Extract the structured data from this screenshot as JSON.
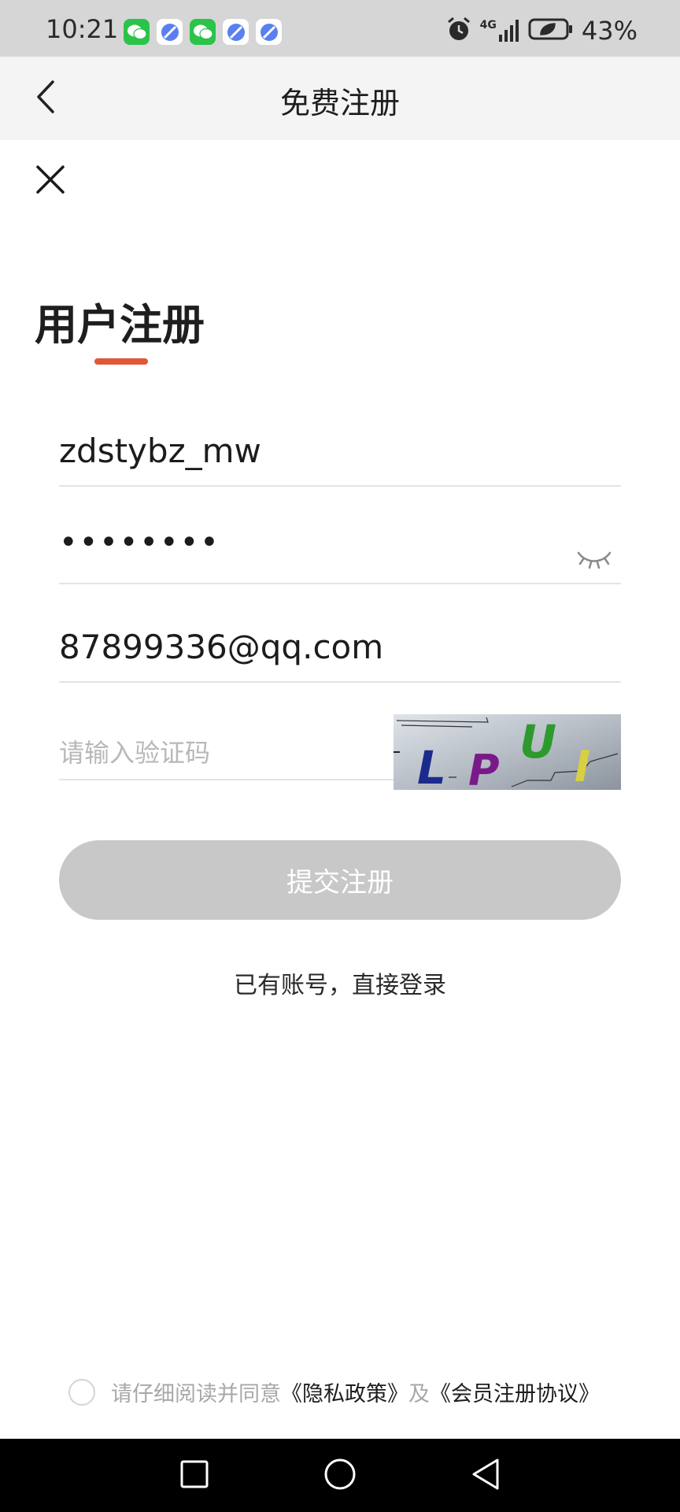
{
  "status_bar": {
    "time": "10:21",
    "notification_icons": [
      "wechat-icon",
      "app-icon",
      "wechat-icon",
      "app-icon",
      "app-icon"
    ],
    "network": "4G",
    "battery_percent": "43%"
  },
  "title_bar": {
    "title": "免费注册",
    "back_icon": "chevron-left-icon"
  },
  "close_icon": "close-icon",
  "form": {
    "heading": "用户注册",
    "accent_color": "#e0573a",
    "username": {
      "value": "zdstybz_mw"
    },
    "password": {
      "value": "••••••••",
      "toggle_icon": "eye-closed-icon"
    },
    "email": {
      "value": "87899336@qq.com"
    },
    "captcha": {
      "placeholder": "请输入验证码",
      "image_text": "LPUI"
    },
    "submit_label": "提交注册",
    "submit_color": "#c8c8c8"
  },
  "login_link": "已有账号，直接登录",
  "agreement": {
    "prefix": "请仔细阅读并同意",
    "privacy_link": "《隐私政策》",
    "conjunction": "及",
    "member_link": "《会员注册协议》"
  },
  "nav_bar": {
    "buttons": [
      "recent-apps-icon",
      "home-icon",
      "back-icon"
    ]
  }
}
